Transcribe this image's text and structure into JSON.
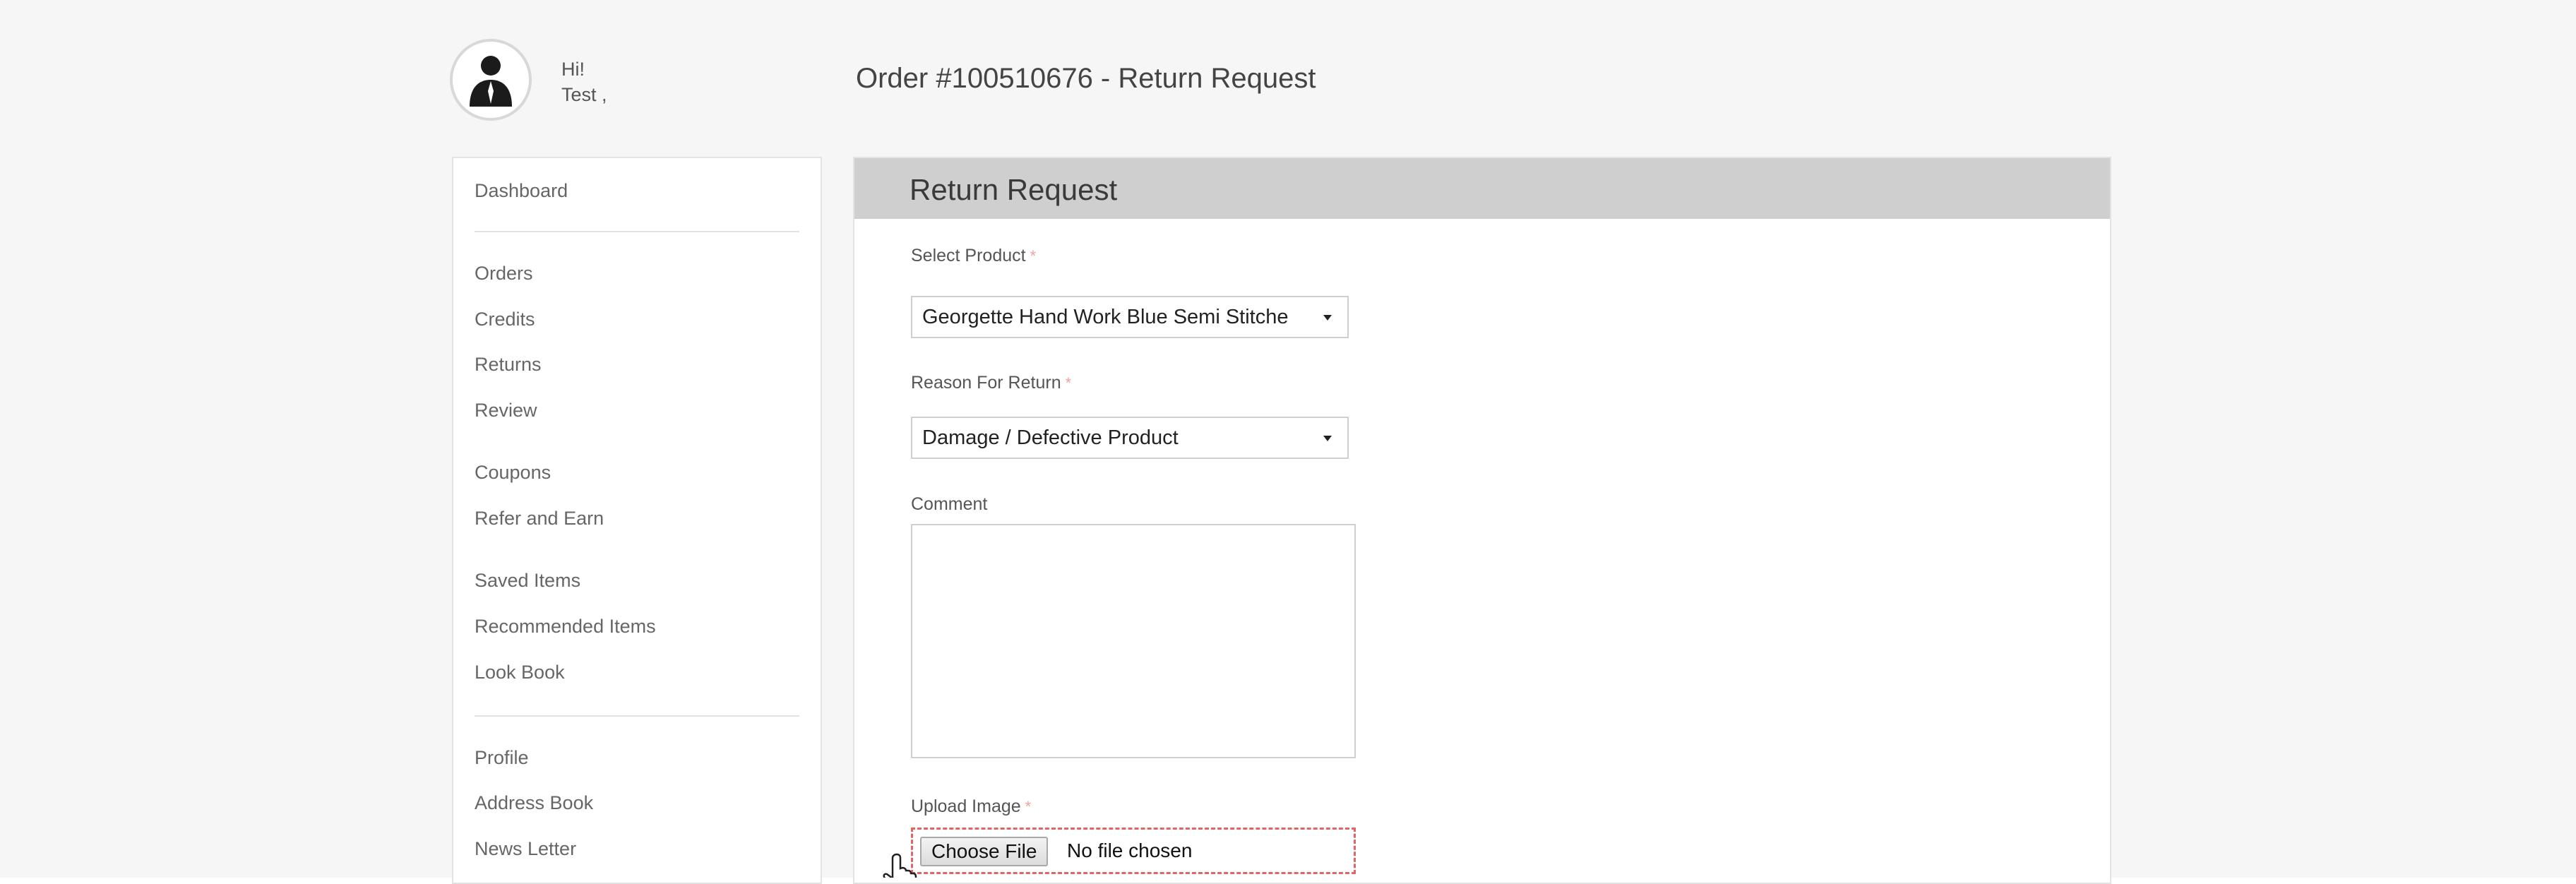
{
  "header": {
    "greeting": "Hi!",
    "user_name": "Test ,",
    "page_title": "Order #100510676 - Return Request"
  },
  "sidebar": {
    "items": [
      {
        "label": "Dashboard"
      },
      {
        "label": "Orders"
      },
      {
        "label": "Credits"
      },
      {
        "label": "Returns"
      },
      {
        "label": "Review"
      },
      {
        "label": "Coupons"
      },
      {
        "label": "Refer and Earn"
      },
      {
        "label": "Saved Items"
      },
      {
        "label": "Recommended Items"
      },
      {
        "label": "Look Book"
      },
      {
        "label": "Profile"
      },
      {
        "label": "Address Book"
      },
      {
        "label": "News Letter"
      }
    ]
  },
  "form": {
    "title": "Return Request",
    "select_product": {
      "label": "Select Product",
      "required_mark": "*",
      "value": "Georgette Hand Work Blue Semi Stitche"
    },
    "reason": {
      "label": "Reason For Return",
      "required_mark": "*",
      "value": "Damage / Defective Product"
    },
    "comment": {
      "label": "Comment",
      "value": ""
    },
    "upload": {
      "label": "Upload Image",
      "required_mark": "*",
      "button_label": "Choose File",
      "status": "No file chosen"
    }
  },
  "icons": {
    "avatar": "user-avatar-icon",
    "cursor": "hand-pointer-icon",
    "dropdown": "chevron-down-icon"
  },
  "colors": {
    "panel_header_bg": "#cfcfcf",
    "required_mark": "#f2a0a0",
    "upload_border": "#e26565"
  }
}
